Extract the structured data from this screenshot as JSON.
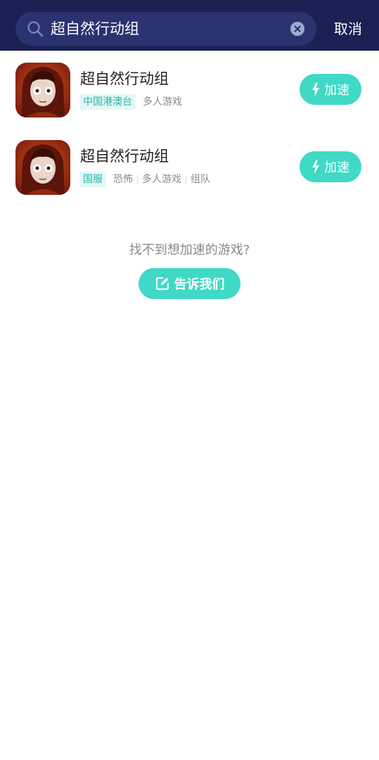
{
  "search": {
    "query": "超自然行动组",
    "cancel_label": "取消"
  },
  "results": [
    {
      "title": "超自然行动组",
      "region": "中国港澳台",
      "tags": [
        "多人游戏"
      ],
      "boost_label": "加速"
    },
    {
      "title": "超自然行动组",
      "region": "国服",
      "tags": [
        "恐怖",
        "多人游戏",
        "组队"
      ],
      "boost_label": "加速"
    }
  ],
  "feedback": {
    "prompt": "找不到想加速的游戏?",
    "button_label": "告诉我们"
  },
  "colors": {
    "header_bg": "#1b2152",
    "accent": "#3fd9c6"
  },
  "icons": [
    "search-icon",
    "clear-icon",
    "lightning-icon",
    "edit-icon"
  ]
}
